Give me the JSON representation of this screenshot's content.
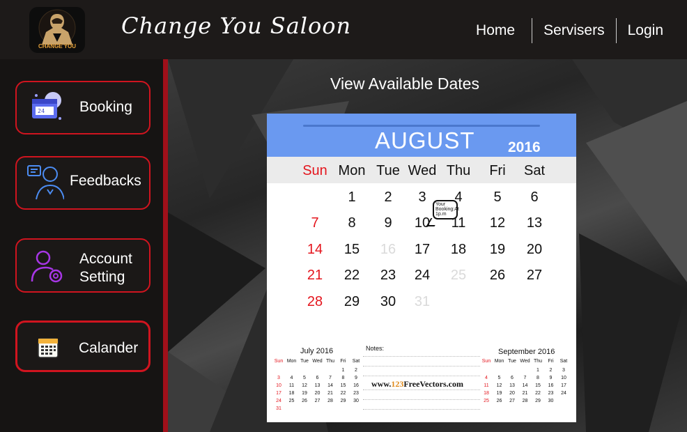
{
  "header": {
    "logo_text": "CHANGE YOU",
    "brand": "Change You Saloon",
    "nav": [
      "Home",
      "Servisers",
      "Login"
    ]
  },
  "sidebar": {
    "items": [
      {
        "label": "Booking",
        "icon": "booking-icon"
      },
      {
        "label": "Feedbacks",
        "icon": "feedback-icon"
      },
      {
        "label_line1": "Account",
        "label_line2": "Setting",
        "icon": "account-settings-icon"
      },
      {
        "label": "Calander",
        "icon": "calendar-icon"
      }
    ]
  },
  "main": {
    "title": "View Available Dates"
  },
  "calendar": {
    "month": "AUGUST",
    "year": "2016",
    "days_of_week": [
      "Sun",
      "Mon",
      "Tue",
      "Wed",
      "Thu",
      "Fri",
      "Sat"
    ],
    "weeks": [
      [
        "",
        "1",
        "2",
        "3",
        "4",
        "5",
        "6"
      ],
      [
        "7",
        "8",
        "9",
        "10",
        "11",
        "12",
        "13"
      ],
      [
        "14",
        "15",
        "16",
        "17",
        "18",
        "19",
        "20"
      ],
      [
        "21",
        "22",
        "23",
        "24",
        "25",
        "26",
        "27"
      ],
      [
        "28",
        "29",
        "30",
        "31",
        "",
        "",
        ""
      ]
    ],
    "unavailable_days": [
      "16",
      "25",
      "31"
    ],
    "booking_note": "Your Booking:At 1p.m",
    "notes_label": "Notes:",
    "watermark_prefix": "www.",
    "watermark_number": "123",
    "watermark_suffix": "FreeVectors.com",
    "prev_month": {
      "title": "July 2016",
      "dow": [
        "Sun",
        "Mon",
        "Tue",
        "Wed",
        "Thu",
        "Fri",
        "Sat"
      ],
      "weeks": [
        [
          "",
          "",
          "",
          "",
          "",
          "1",
          "2"
        ],
        [
          "3",
          "4",
          "5",
          "6",
          "7",
          "8",
          "9"
        ],
        [
          "10",
          "11",
          "12",
          "13",
          "14",
          "15",
          "16"
        ],
        [
          "17",
          "18",
          "19",
          "20",
          "21",
          "22",
          "23"
        ],
        [
          "24",
          "25",
          "26",
          "27",
          "28",
          "29",
          "30"
        ],
        [
          "31",
          "",
          "",
          "",
          "",
          "",
          ""
        ]
      ]
    },
    "next_month": {
      "title": "September 2016",
      "dow": [
        "Sun",
        "Mon",
        "Tue",
        "Wed",
        "Thu",
        "Fri",
        "Sat"
      ],
      "weeks": [
        [
          "",
          "",
          "",
          "",
          "1",
          "2",
          "3"
        ],
        [
          "4",
          "5",
          "6",
          "7",
          "8",
          "9",
          "10"
        ],
        [
          "11",
          "12",
          "13",
          "14",
          "15",
          "16",
          "17"
        ],
        [
          "18",
          "19",
          "20",
          "21",
          "22",
          "23",
          "24"
        ],
        [
          "25",
          "26",
          "27",
          "28",
          "29",
          "30",
          ""
        ]
      ]
    }
  },
  "colors": {
    "accent_red": "#d0141f",
    "calendar_header": "#6a99f0",
    "sunday_red": "#e4151d"
  }
}
